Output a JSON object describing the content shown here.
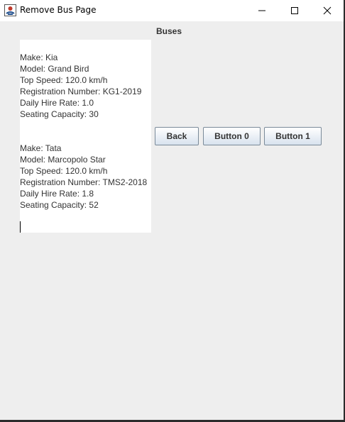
{
  "window": {
    "title": "Remove Bus Page"
  },
  "icons": {
    "app": "java-app-icon",
    "minimize": "minimize-icon",
    "maximize": "maximize-icon",
    "close": "close-icon"
  },
  "heading": "Buses",
  "buses": [
    {
      "make": "Make: Kia",
      "model": "Model: Grand Bird",
      "top_speed": "Top Speed: 120.0 km/h",
      "registration": "Registration Number: KG1-2019",
      "hire_rate": "Daily Hire Rate: 1.0",
      "capacity": "Seating Capacity: 30"
    },
    {
      "make": "Make: Tata",
      "model": "Model: Marcopolo Star",
      "top_speed": "Top Speed: 120.0 km/h",
      "registration": "Registration Number: TMS2-2018",
      "hire_rate": "Daily Hire Rate: 1.8",
      "capacity": "Seating Capacity: 52"
    }
  ],
  "buttons": {
    "back": "Back",
    "button0": "Button 0",
    "button1": "Button 1"
  }
}
